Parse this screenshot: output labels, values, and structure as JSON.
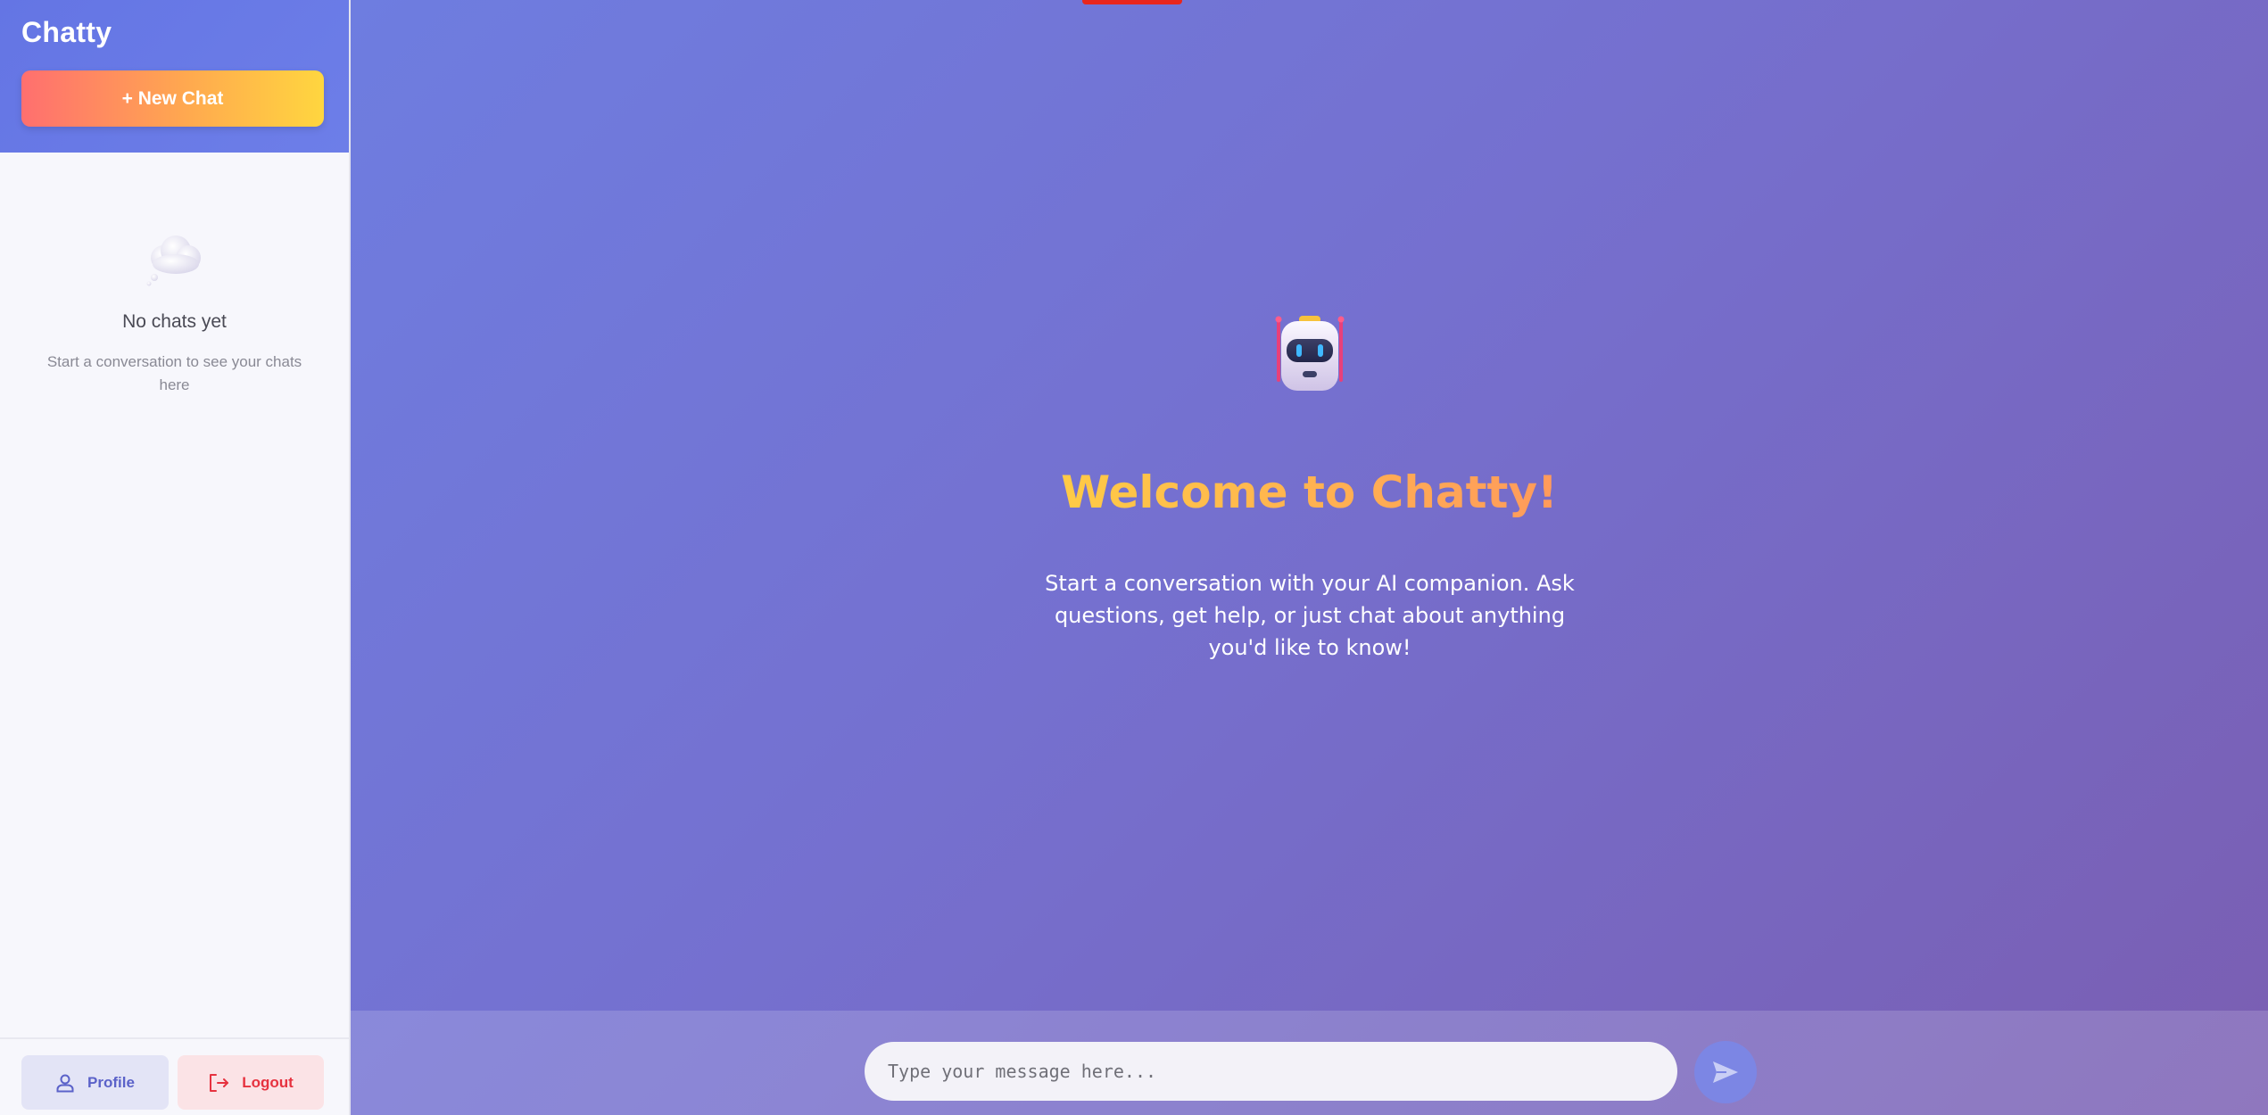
{
  "sidebar": {
    "app_title": "Chatty",
    "new_chat_label": "+ New Chat",
    "empty_state": {
      "icon": "thought-cloud-icon",
      "title": "No chats yet",
      "subtitle": "Start a conversation to see your chats here"
    },
    "footer": {
      "profile_label": "Profile",
      "profile_icon": "user-icon",
      "logout_label": "Logout",
      "logout_icon": "logout-icon"
    }
  },
  "main": {
    "hero_icon": "robot-icon",
    "welcome_title": "Welcome to Chatty!",
    "welcome_description": "Start a conversation with your AI companion. Ask questions, get help, or just chat about anything you'd like to know!",
    "input": {
      "placeholder": "Type your message here...",
      "value": ""
    },
    "send_icon": "send-icon"
  },
  "colors": {
    "brand_gradient_start": "#6e7de0",
    "brand_gradient_end": "#7a5eb2",
    "new_chat_gradient": [
      "#ff6f6f",
      "#ffd63f"
    ],
    "title_gradient": [
      "#ffcb45",
      "#ff9a5c"
    ],
    "logout_red": "#e6323f",
    "profile_blue": "#5b62c9"
  }
}
